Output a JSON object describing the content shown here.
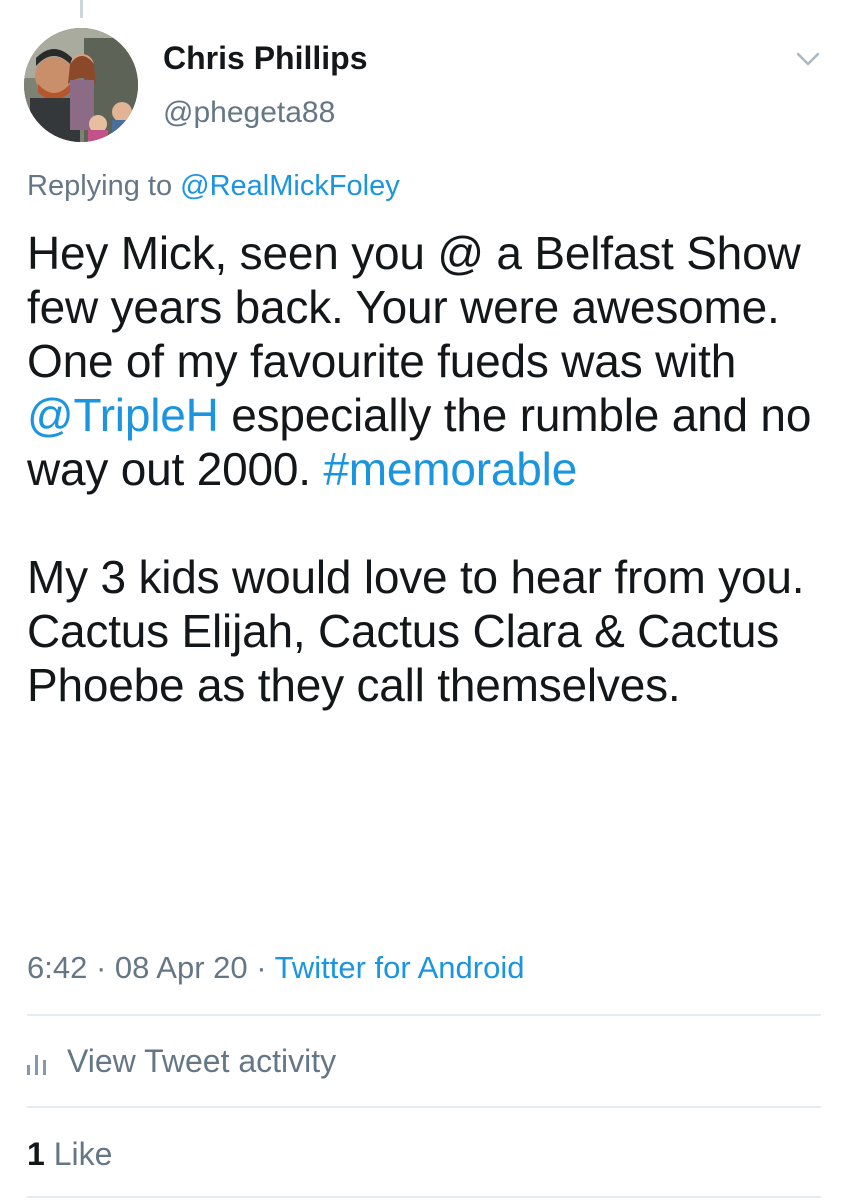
{
  "author": {
    "name": "Chris Phillips",
    "handle": "@phegeta88",
    "avatar_icon": "profile-photo"
  },
  "reply": {
    "prefix": "Replying to ",
    "mention": "@RealMickFoley"
  },
  "tweet": {
    "p1_a": "Hey Mick, seen you @ a Belfast Show few years back. Your were awesome. One of my favourite fueds was with ",
    "p1_mention": "@TripleH",
    "p1_b": " especially the rumble and no way out 2000. ",
    "p1_hashtag": "#memorable",
    "p2": "My 3 kids would love to hear from you. Cactus Elijah, Cactus Clara & Cactus Phoebe as they call themselves."
  },
  "meta": {
    "time": "6:42",
    "sep1": " · ",
    "date": "08 Apr 20",
    "sep2": " · ",
    "source": "Twitter for Android"
  },
  "activity": {
    "label": "View Tweet activity",
    "icon": "activity-bars-icon"
  },
  "engagement": {
    "like_count": "1",
    "like_label": " Like"
  },
  "colors": {
    "link": "#1b95e0",
    "secondary_text": "#657786",
    "primary_text": "#14171a",
    "divider": "#e6ecf0"
  }
}
